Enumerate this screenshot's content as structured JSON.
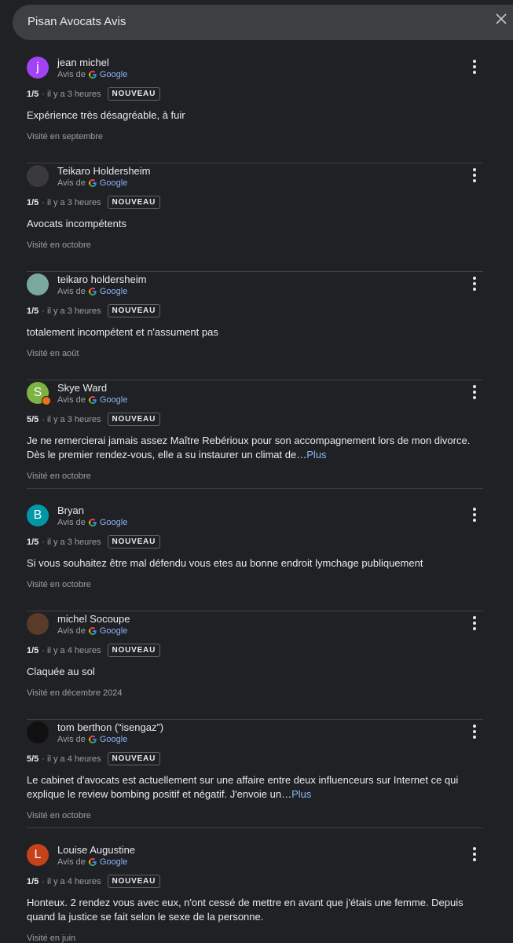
{
  "header": {
    "title": "Pisan Avocats Avis"
  },
  "common": {
    "source_prefix": "Avis de",
    "source_name": "Google",
    "more_label": "Plus"
  },
  "reviews": [
    {
      "initial": "j",
      "avatar_color": "#a142f4",
      "has_badge": false,
      "name": "jean michel",
      "rating": "1/5",
      "time": "· il y a 3 heures",
      "badge": "NOUVEAU",
      "text": "Expérience très désagréable, à fuir",
      "truncated": false,
      "visited": "Visité en septembre"
    },
    {
      "initial": "",
      "avatar_color": "#3a3a3a",
      "has_badge": false,
      "name": "Teikaro Holdersheim",
      "rating": "1/5",
      "time": "· il y a 3 heures",
      "badge": "NOUVEAU",
      "text": "Avocats incompétents",
      "truncated": false,
      "visited": "Visité en octobre"
    },
    {
      "initial": "",
      "avatar_color": "#7aa7a0",
      "has_badge": false,
      "name": "teikaro holdersheim",
      "rating": "1/5",
      "time": "· il y a 3 heures",
      "badge": "NOUVEAU",
      "text": "totalement incompétent et n'assument pas",
      "truncated": false,
      "visited": "Visité en août"
    },
    {
      "initial": "S",
      "avatar_color": "#7cb342",
      "has_badge": true,
      "name": "Skye Ward",
      "rating": "5/5",
      "time": "· il y a 3 heures",
      "badge": "NOUVEAU",
      "text": "Je ne remercierai jamais assez Maître Rebérioux pour son accompagnement lors de mon divorce. Dès le premier rendez-vous, elle a su instaurer un climat de…",
      "truncated": true,
      "visited": "Visité en octobre"
    },
    {
      "initial": "B",
      "avatar_color": "#0097a7",
      "has_badge": false,
      "name": "Bryan",
      "rating": "1/5",
      "time": "· il y a 3 heures",
      "badge": "NOUVEAU",
      "text": "Si vous souhaitez être mal défendu vous etes au bonne endroit lymchage publiquement",
      "truncated": false,
      "visited": "Visité en octobre"
    },
    {
      "initial": "",
      "avatar_color": "#5a3a2a",
      "has_badge": false,
      "name": "michel Socoupe",
      "rating": "1/5",
      "time": "· il y a 4 heures",
      "badge": "NOUVEAU",
      "text": "Claquée au sol",
      "truncated": false,
      "visited": "Visité en décembre 2024"
    },
    {
      "initial": "",
      "avatar_color": "#111111",
      "has_badge": false,
      "name": "tom berthon (“isengaz”)",
      "rating": "5/5",
      "time": "· il y a 4 heures",
      "badge": "NOUVEAU",
      "text": "Le cabinet d'avocats est actuellement sur une affaire entre deux influenceurs sur Internet ce qui explique le review bombing positif et négatif. J'envoie un…",
      "truncated": true,
      "visited": "Visité en octobre"
    },
    {
      "initial": "L",
      "avatar_color": "#c5421a",
      "has_badge": false,
      "name": "Louise Augustine",
      "rating": "1/5",
      "time": "· il y a 4 heures",
      "badge": "NOUVEAU",
      "text": "Honteux. 2 rendez vous avec eux, n'ont cessé de mettre en avant que j'étais une femme. Depuis quand la justice se fait selon le sexe de la personne.",
      "truncated": false,
      "visited": "Visité en juin"
    }
  ]
}
